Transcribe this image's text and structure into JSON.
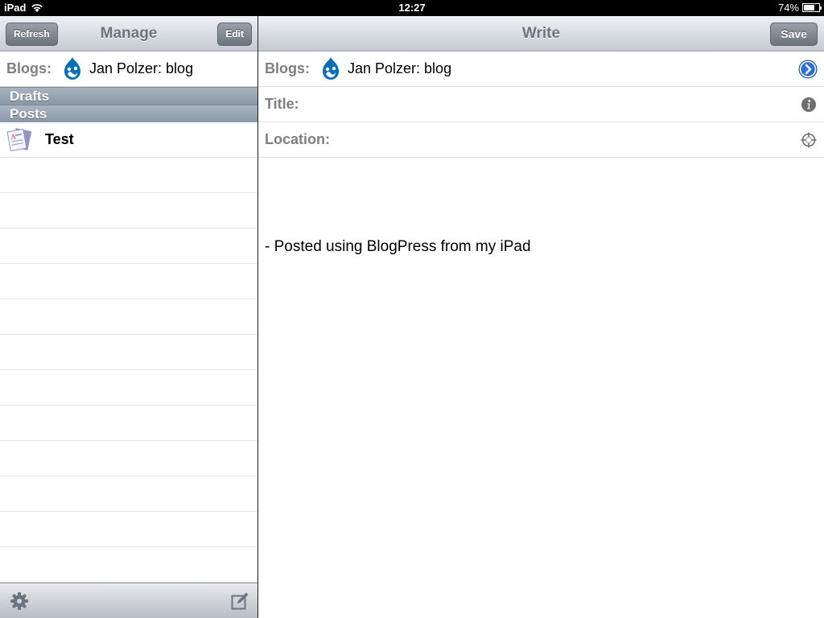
{
  "status_bar": {
    "carrier": "iPad",
    "time": "12:27",
    "battery_percent": "74%",
    "battery_level": 0.74
  },
  "manage": {
    "title": "Manage",
    "refresh_label": "Refresh",
    "edit_label": "Edit",
    "blogs_label": "Blogs:",
    "blog_name": "Jan Polzer: blog",
    "sections": {
      "drafts": "Drafts",
      "posts": "Posts"
    },
    "posts": [
      {
        "title": "Test",
        "icon": "document-icon"
      }
    ],
    "toolbar": {
      "settings_icon": "gear-icon",
      "compose_icon": "compose-icon"
    }
  },
  "write": {
    "title": "Write",
    "save_label": "Save",
    "blogs_label": "Blogs:",
    "blog_name": "Jan Polzer: blog",
    "title_label": "Title:",
    "location_label": "Location:",
    "body": "- Posted using BlogPress from my iPad"
  },
  "colors": {
    "drupal_blue": "#0a6fb5",
    "section_header": "#8a98a6",
    "nav_title": "#6d7580"
  }
}
